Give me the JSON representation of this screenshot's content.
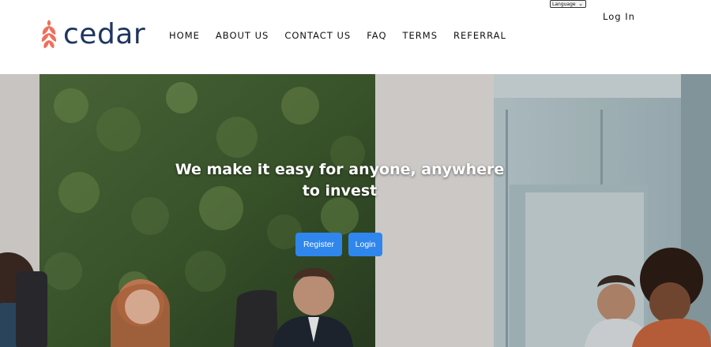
{
  "brand": {
    "name": "cedar",
    "logo_icon": "pinecone-icon",
    "colors": {
      "text": "#1f3660",
      "accent": "#ef6f5c"
    }
  },
  "nav": {
    "items": [
      "HOME",
      "ABOUT US",
      "CONTACT US",
      "FAQ",
      "TERMS",
      "REFERRAL"
    ]
  },
  "language_select": {
    "selected": "Language"
  },
  "auth": {
    "login_link": "Log In"
  },
  "hero": {
    "title": "We make it easy for anyone, anywhere to invest",
    "register_button": "Register",
    "login_button": "Login",
    "button_color": "#2f86ec"
  }
}
